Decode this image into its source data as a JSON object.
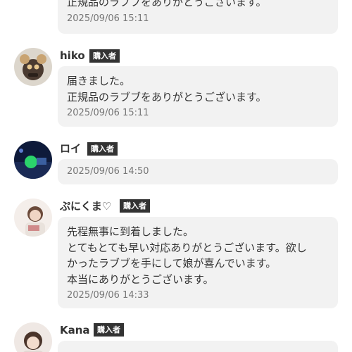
{
  "reviews": [
    {
      "lines": [
        "正規品のラブブをありがとうございます。"
      ],
      "date": "2025/09/06 15:11"
    },
    {
      "name": "hiko",
      "badge": "購入者",
      "lines": [
        "届きました。",
        "正規品のラブブをありがとうございます。"
      ],
      "date": "2025/09/06 15:11"
    },
    {
      "name": "ロイ",
      "badge": "購入者",
      "lines": [],
      "date": "2025/09/06 14:50"
    },
    {
      "name": "ぷにくま♡",
      "badge": "購入者",
      "lines": [
        "先程無事に到着しました。",
        "とてもとても早い対応ありがとうございます。欲し",
        "かったラブブを手にして娘が喜んでいます。",
        "本当にありがとうございます。"
      ],
      "date": "2025/09/06 14:33"
    },
    {
      "name": "Kana",
      "badge": "購入者"
    }
  ]
}
